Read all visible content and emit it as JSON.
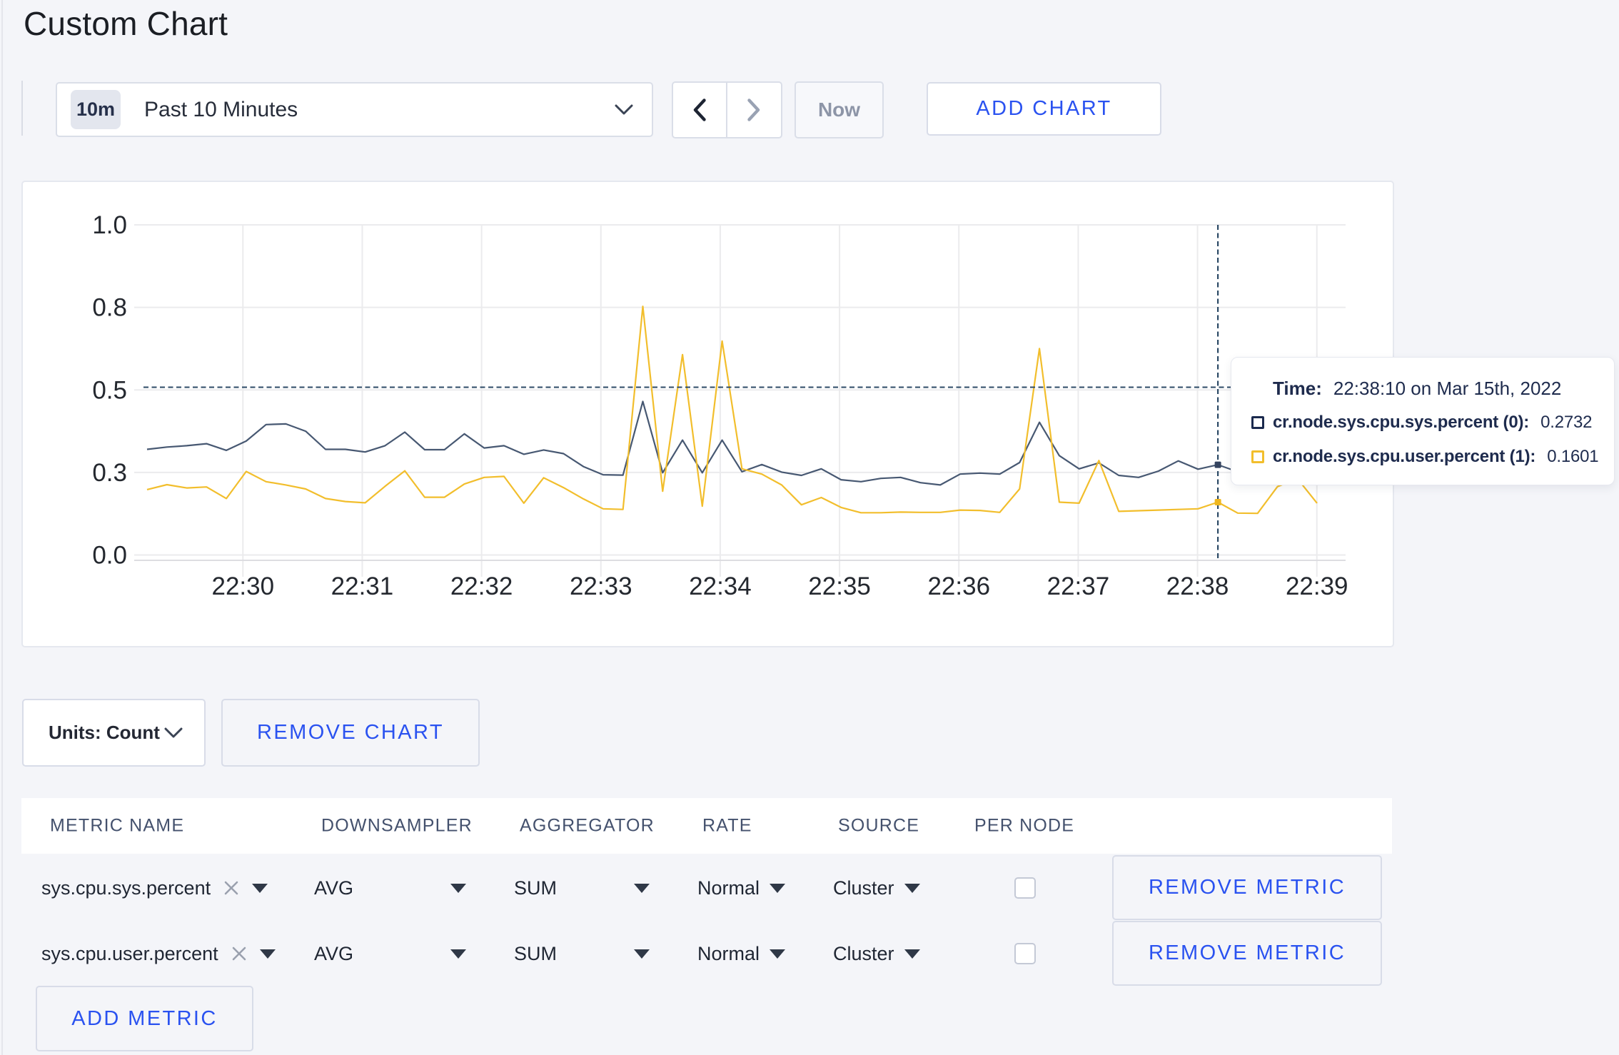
{
  "page_title": "Custom Chart",
  "toolbar": {
    "timescale_badge": "10m",
    "timescale_label": "Past 10 Minutes",
    "now_label": "Now",
    "add_chart_label": "ADD CHART"
  },
  "chart_controls": {
    "units_label": "Units: Count",
    "remove_chart_label": "REMOVE CHART",
    "add_metric_label": "ADD METRIC"
  },
  "tooltip": {
    "time_label": "Time:",
    "time_value": "22:38:10 on Mar 15th, 2022",
    "series": [
      {
        "label": "cr.node.sys.cpu.sys.percent (0):",
        "value": "0.2732",
        "color": "#1b2a4e"
      },
      {
        "label": "cr.node.sys.cpu.user.percent (1):",
        "value": "0.1601",
        "color": "#f2be2c"
      }
    ]
  },
  "metrics_table": {
    "headers": [
      "METRIC NAME",
      "DOWNSAMPLER",
      "AGGREGATOR",
      "RATE",
      "SOURCE",
      "PER NODE"
    ],
    "remove_metric_label": "REMOVE METRIC",
    "rows": [
      {
        "metric": "sys.cpu.sys.percent",
        "downsampler": "AVG",
        "aggregator": "SUM",
        "rate": "Normal",
        "source": "Cluster",
        "per_node": false
      },
      {
        "metric": "sys.cpu.user.percent",
        "downsampler": "AVG",
        "aggregator": "SUM",
        "rate": "Normal",
        "source": "Cluster",
        "per_node": false
      }
    ]
  },
  "chart_data": {
    "type": "line",
    "title": "",
    "xlabel": "",
    "ylabel": "",
    "x_start": "22:29:10",
    "x_step_seconds": 10,
    "x_tick_labels": [
      "22:30",
      "22:31",
      "22:32",
      "22:33",
      "22:34",
      "22:35",
      "22:36",
      "22:37",
      "22:38",
      "22:39"
    ],
    "y_ticks": [
      {
        "v": 0.0,
        "label": "0.0"
      },
      {
        "v": 0.25,
        "label": "0.3"
      },
      {
        "v": 0.5,
        "label": "0.5"
      },
      {
        "v": 0.75,
        "label": "0.8"
      },
      {
        "v": 1.0,
        "label": "1.0"
      }
    ],
    "ylim": [
      0,
      1
    ],
    "grid": true,
    "series": [
      {
        "name": "cr.node.sys.cpu.sys.percent",
        "color": "#475872",
        "marker_color": "#35445f",
        "values": [
          0.32,
          0.327,
          0.331,
          0.337,
          0.317,
          0.345,
          0.395,
          0.397,
          0.375,
          0.32,
          0.32,
          0.312,
          0.331,
          0.372,
          0.319,
          0.319,
          0.367,
          0.324,
          0.331,
          0.305,
          0.318,
          0.307,
          0.268,
          0.243,
          0.242,
          0.465,
          0.249,
          0.348,
          0.249,
          0.348,
          0.252,
          0.274,
          0.251,
          0.241,
          0.261,
          0.228,
          0.222,
          0.232,
          0.235,
          0.219,
          0.212,
          0.245,
          0.248,
          0.245,
          0.28,
          0.402,
          0.301,
          0.261,
          0.279,
          0.241,
          0.235,
          0.254,
          0.285,
          0.26,
          0.2732,
          0.252,
          0.248,
          0.258,
          0.247,
          0.252
        ]
      },
      {
        "name": "cr.node.sys.cpu.user.percent",
        "color": "#f2be2c",
        "marker_color": "#efb71f",
        "values": [
          0.198,
          0.213,
          0.203,
          0.206,
          0.171,
          0.253,
          0.222,
          0.212,
          0.2,
          0.171,
          0.162,
          0.158,
          0.208,
          0.255,
          0.175,
          0.175,
          0.215,
          0.235,
          0.238,
          0.157,
          0.234,
          0.204,
          0.17,
          0.14,
          0.138,
          0.753,
          0.193,
          0.607,
          0.148,
          0.648,
          0.261,
          0.245,
          0.212,
          0.152,
          0.174,
          0.144,
          0.128,
          0.128,
          0.13,
          0.129,
          0.129,
          0.136,
          0.135,
          0.129,
          0.2,
          0.625,
          0.16,
          0.157,
          0.286,
          0.132,
          0.134,
          0.136,
          0.138,
          0.14,
          0.1601,
          0.127,
          0.126,
          0.207,
          0.232,
          0.157
        ]
      }
    ],
    "crosshair": {
      "index": 54,
      "y_value": 0.508
    },
    "legend_position": "tooltip"
  }
}
